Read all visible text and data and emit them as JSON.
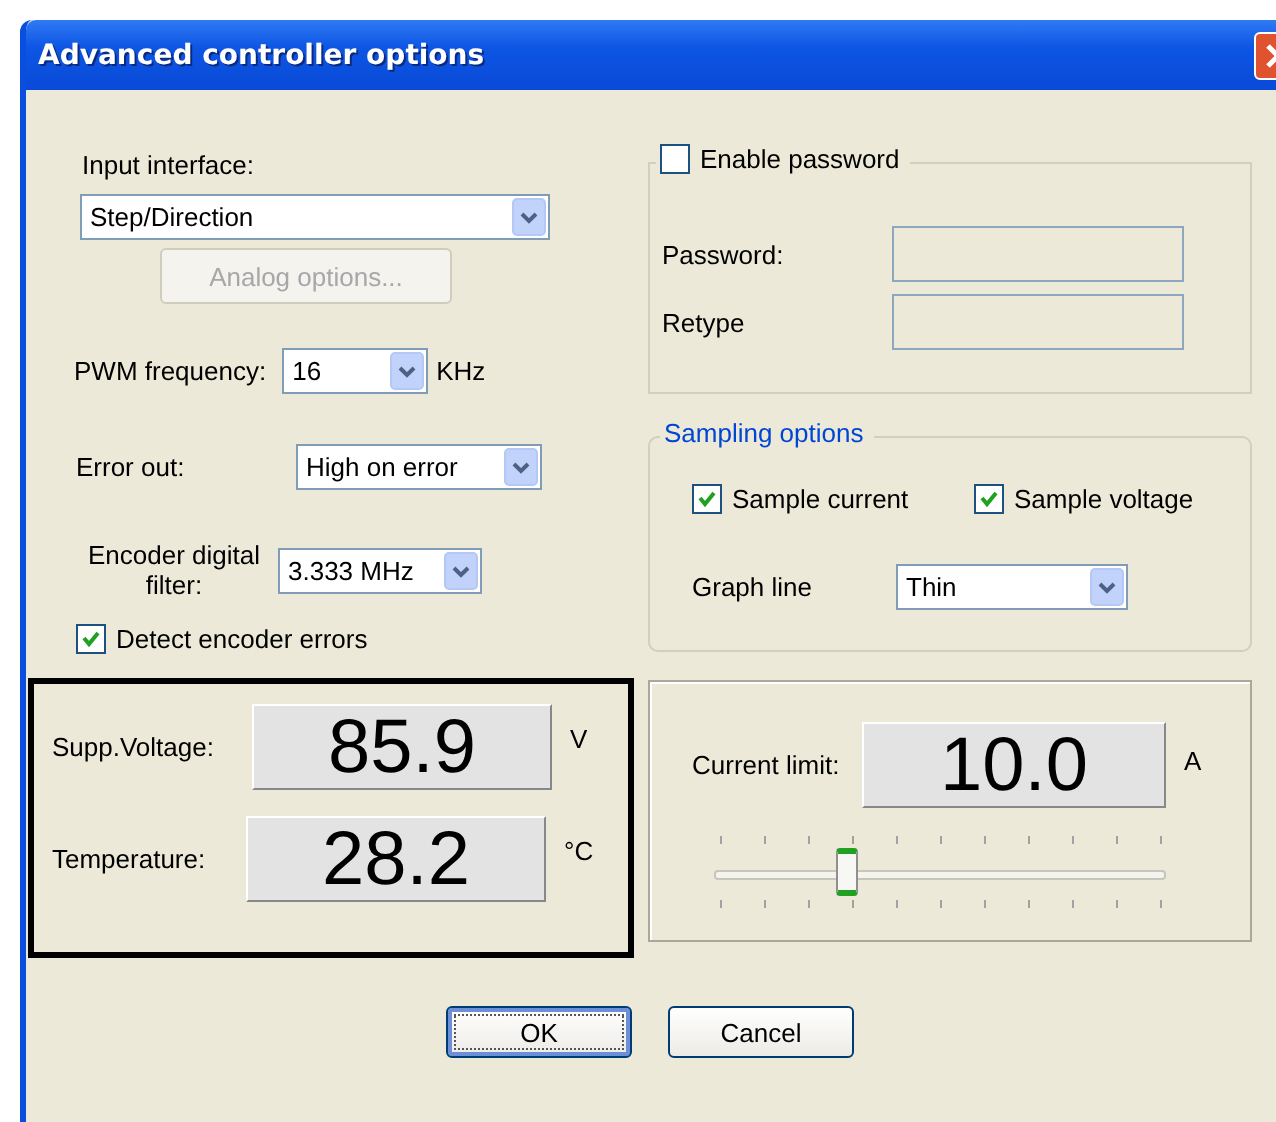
{
  "window": {
    "title": "Advanced controller options"
  },
  "input_interface": {
    "label": "Input interface:",
    "value": "Step/Direction"
  },
  "analog_options_button": {
    "label": "Analog options...",
    "disabled": true
  },
  "pwm_frequency": {
    "label": "PWM frequency:",
    "value": "16",
    "unit": "KHz"
  },
  "error_out": {
    "label": "Error out:",
    "value": "High on error"
  },
  "encoder_filter": {
    "label": "Encoder  digital filter:",
    "value": "3.333 MHz"
  },
  "detect_encoder_errors": {
    "label": "Detect encoder errors",
    "checked": true
  },
  "readings": [
    {
      "label": "Supp.Voltage:",
      "value": "85.9",
      "unit": "V"
    },
    {
      "label": "Temperature:",
      "value": "28.2",
      "unit": "°C"
    }
  ],
  "password_group": {
    "label": "Enable password",
    "checked": false,
    "fields": [
      {
        "label": "Password:"
      },
      {
        "label": "Retype"
      }
    ]
  },
  "sampling": {
    "title": "Sampling options",
    "options": [
      {
        "label": "Sample current",
        "checked": true
      },
      {
        "label": "Sample voltage",
        "checked": true
      }
    ],
    "graph_line": {
      "label": "Graph line",
      "value": "Thin"
    }
  },
  "current_limit": {
    "label": "Current limit:",
    "value": "10.0",
    "unit": "A",
    "level": 0.29
  },
  "buttons": [
    {
      "label": "OK",
      "default": true
    },
    {
      "label": "Cancel",
      "default": false
    }
  ]
}
